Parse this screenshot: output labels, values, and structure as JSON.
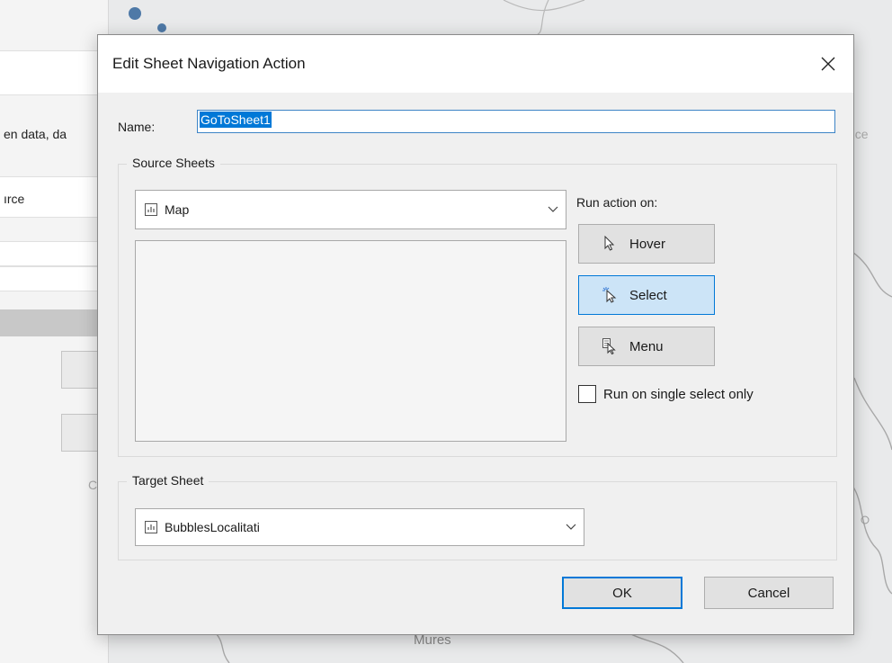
{
  "background": {
    "panel_text_1": "en data, da",
    "panel_text_2": "ırce",
    "map_label_right": "uce",
    "map_label_bottom": "Mures",
    "map_label_left": "C"
  },
  "dialog": {
    "title": "Edit Sheet Navigation Action",
    "name_label": "Name:",
    "name_value": "GoToSheet1",
    "source_group_label": "Source Sheets",
    "source_sheet": {
      "selected": "Map",
      "icon": "worksheet-icon"
    },
    "run_action_label": "Run action on:",
    "actions": [
      {
        "id": "hover",
        "label": "Hover",
        "icon": "cursor-arrow-icon",
        "active": false
      },
      {
        "id": "select",
        "label": "Select",
        "icon": "cursor-select-icon",
        "active": true
      },
      {
        "id": "menu",
        "label": "Menu",
        "icon": "cursor-menu-icon",
        "active": false
      }
    ],
    "single_select_label": "Run on single select only",
    "single_select_checked": false,
    "target_group_label": "Target Sheet",
    "target_sheet": {
      "selected": "BubblesLocalitati",
      "icon": "worksheet-icon"
    },
    "ok_label": "OK",
    "cancel_label": "Cancel"
  },
  "colors": {
    "accent": "#0078d7",
    "active_button_bg": "#cce4f7",
    "map_dot": "#4e79a7"
  }
}
